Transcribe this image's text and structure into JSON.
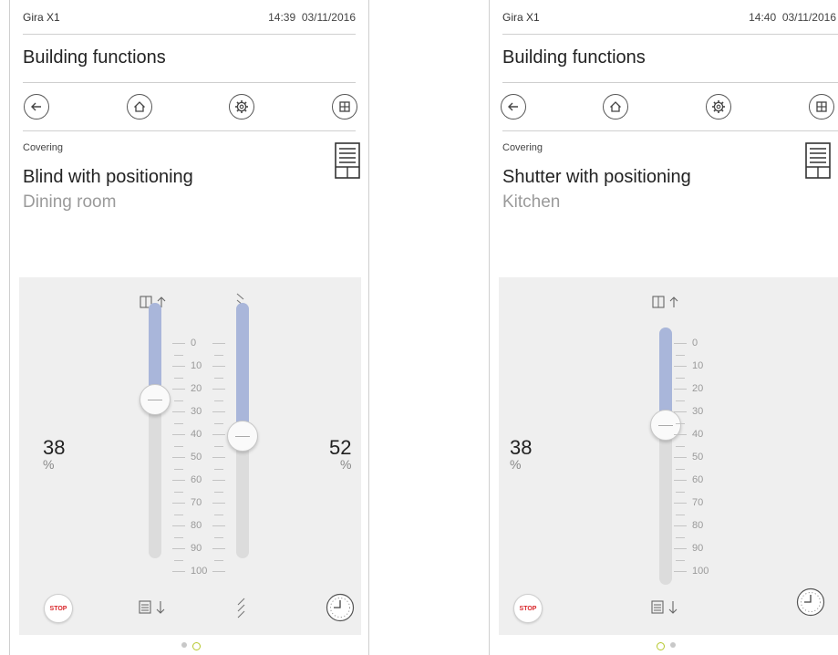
{
  "screens": [
    {
      "device": "Gira X1",
      "time": "14:39",
      "date": "03/11/2016",
      "title": "Building functions",
      "category": "Covering",
      "function_name": "Blind with positioning",
      "room": "Dining room",
      "position_value": "38",
      "position_unit": "%",
      "slat_value": "52",
      "slat_unit": "%",
      "position_fraction": 0.38,
      "slat_fraction": 0.52,
      "stop_label": "STOP",
      "scale": [
        "0",
        "10",
        "20",
        "30",
        "40",
        "50",
        "60",
        "70",
        "80",
        "90",
        "100"
      ],
      "active_page": 2
    },
    {
      "device": "Gira X1",
      "time": "14:40",
      "date": "03/11/2016",
      "title": "Building functions",
      "category": "Covering",
      "function_name": "Shutter with positioning",
      "room": "Kitchen",
      "position_value": "38",
      "position_unit": "%",
      "position_fraction": 0.38,
      "stop_label": "STOP",
      "scale": [
        "0",
        "10",
        "20",
        "30",
        "40",
        "50",
        "60",
        "70",
        "80",
        "90",
        "100"
      ],
      "active_page": 1
    }
  ],
  "icons": {
    "back": "arrow-left-icon",
    "home": "home-icon",
    "settings": "gear-icon",
    "grid": "grid-icon",
    "device": "blind-icon",
    "up": "window-up-icon",
    "down": "blind-down-icon",
    "slat_open": "slat-open-icon",
    "slat_close": "slat-close-icon",
    "timer": "clock-icon"
  },
  "colors": {
    "fill": "#a9b6da",
    "track": "#dcdcdc",
    "stop_text": "#d9262a",
    "active_page_dot": "#b6c82c",
    "room_text": "#9a9a9a"
  }
}
